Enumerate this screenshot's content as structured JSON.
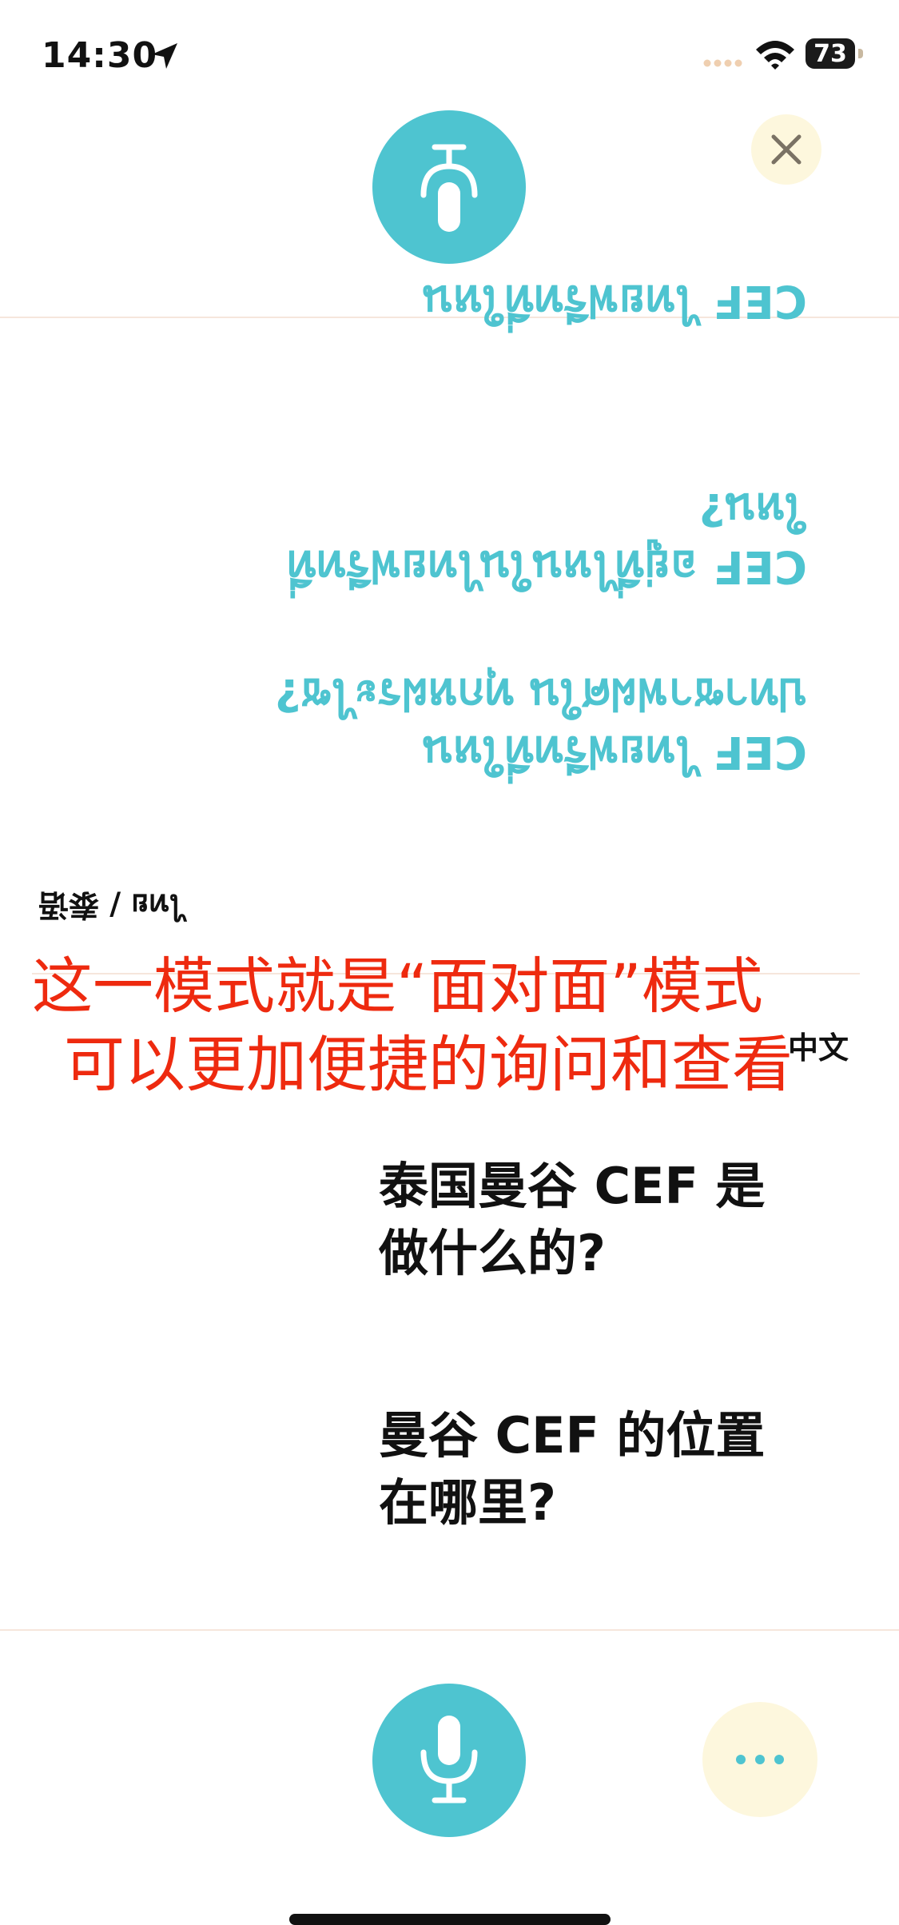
{
  "status_bar": {
    "time": "14:30",
    "battery": "73",
    "icons": [
      "location-arrow-icon",
      "signal-icon",
      "wifi-icon",
      "battery-icon"
    ]
  },
  "colors": {
    "accent": "#4ec4d0",
    "soft_button": "#fdf7dd",
    "annotation": "#ee2a0f"
  },
  "partner": {
    "language_label": "ไทย / 泰语",
    "messages": [
      "CEF ไทยฟรีทที่ใหน",
      "CEF อยู่ที่ไหนในไทยฟรีทที่ใหน?",
      "CEF ไทยฟรีทที่ใหน\nปทาซาฟฝศใน ทุกหฝระไซ?"
    ]
  },
  "annotation": {
    "line1": "这一模式就是“面对面”模式",
    "line2": "可以更加便捷的询问和查看"
  },
  "me": {
    "language_label": "中文",
    "messages": [
      "泰国曼谷 CEF 是\n做什么的?",
      "曼谷 CEF 的位置\n在哪里?"
    ]
  },
  "controls": {
    "top_mic_icon": "microphone-icon",
    "close_icon": "close-icon",
    "bottom_mic_icon": "microphone-icon",
    "more_icon": "more-dots-icon"
  }
}
